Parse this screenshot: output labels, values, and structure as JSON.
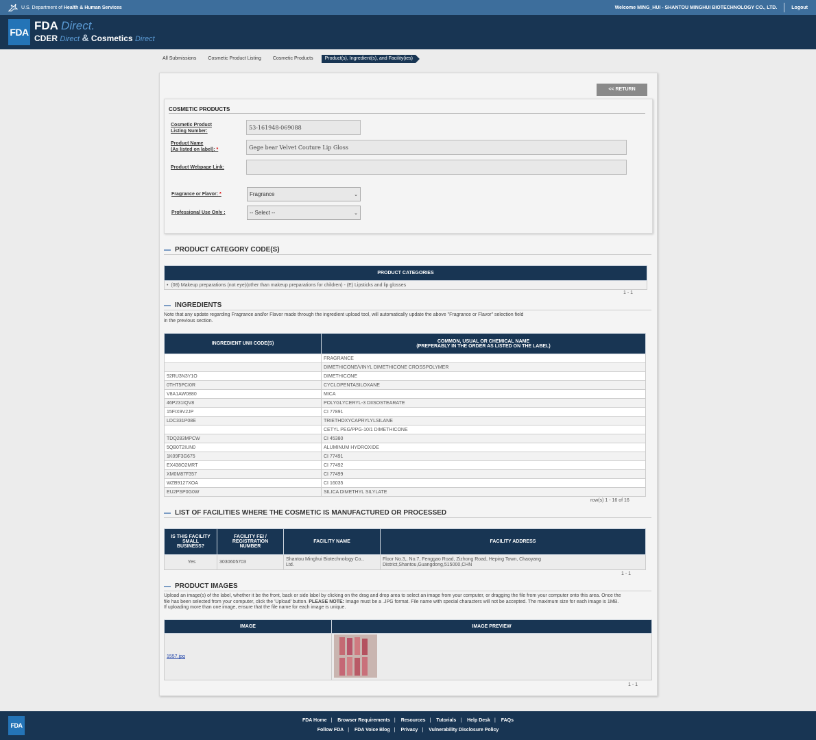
{
  "hhs": {
    "prefix": "U.S. Department of",
    "dept": "Health & Human Services",
    "welcome": "Welcome MING_HUI - SHANTOU MINGHUI BIOTECHNOLOGY CO., LTD.",
    "logout": "Logout"
  },
  "brand": {
    "logo": "FDA",
    "fda": "FDA",
    "direct": "Direct.",
    "cder": "CDER",
    "direct2": "Direct",
    "amp": "&",
    "cosmetics": "Cosmetics",
    "direct3": "Direct"
  },
  "breadcrumbs": [
    "All Submissions",
    "Cosmetic Product Listing",
    "Cosmetic Products",
    "Product(s), Ingredient(s), and Facility(ies)"
  ],
  "return_button": "<< RETURN",
  "cosmetic_products": {
    "title": "COSMETIC PRODUCTS",
    "listing_label_1": "Cosmetic Product",
    "listing_label_2": "Listing Number:",
    "listing_value": "53-161948-069088",
    "name_label_1": "Product Name",
    "name_label_2": "(As listed on label):",
    "name_value": "Gege bear Velvet Couture Lip Gloss",
    "webpage_label": "Product Webpage Link:",
    "webpage_value": "",
    "fragrance_label": "Fragrance or Flavor:",
    "fragrance_value": "Fragrance",
    "professional_label": "Professional Use Only :",
    "professional_value": "-- Select --",
    "required_mark": "*"
  },
  "categories": {
    "title": "PRODUCT CATEGORY CODE(S)",
    "header": "PRODUCT CATEGORIES",
    "bullet": "•",
    "row": "(08) Makeup preparations (not eye)(other than makeup preparations for children) - (E) Lipsticks and lip glosses",
    "pager": "1 - 1"
  },
  "ingredients": {
    "title": "INGREDIENTS",
    "note_1": "Note that any update regarding Fragrance and/or Flavor made through the ingredient upload tool, will automatically update the above \"Fragrance or Flavor\" selection field",
    "note_2": "in the previous section.",
    "col_code": "INGREDIENT UNII CODE(S)",
    "col_name_1": "COMMON, USUAL OR CHEMICAL NAME",
    "col_name_2": "(PREFERABLY IN THE ORDER AS LISTED ON THE LABEL)",
    "rows": [
      {
        "code": "",
        "name": "FRAGRANCE"
      },
      {
        "code": "",
        "name": "DIMETHICONE/VINYL DIMETHICONE CROSSPOLYMER"
      },
      {
        "code": "92RU3N3Y1O",
        "name": "DIMETHICONE"
      },
      {
        "code": "0THT5PCI0R",
        "name": "CYCLOPENTASILOXANE"
      },
      {
        "code": "V8A1AW0880",
        "name": "MICA"
      },
      {
        "code": "46P231IQV8",
        "name": "POLYGLYCERYL-3 DIISOSTEARATE"
      },
      {
        "code": "15FIX9V2JP",
        "name": "CI 77891"
      },
      {
        "code": "LDC331P08E",
        "name": "TRIETHOXYCAPRYLYLSILANE"
      },
      {
        "code": "",
        "name": "CETYL PEG/PPG-10/1 DIMETHICONE"
      },
      {
        "code": "TDQ283MPCW",
        "name": "CI 45380"
      },
      {
        "code": "5QB0T2IUN0",
        "name": "ALUMINUM HYDROXIDE"
      },
      {
        "code": "1K09F3G675",
        "name": "CI 77491"
      },
      {
        "code": "EX438O2MRT",
        "name": "CI 77492"
      },
      {
        "code": "XM0M87F357",
        "name": "CI 77499"
      },
      {
        "code": "WZB9127XOA",
        "name": "CI 16035"
      },
      {
        "code": "EU2PSP0G0W",
        "name": "SILICA DIMETHYL SILYLATE"
      }
    ],
    "pager": "row(s) 1 - 16 of 16"
  },
  "facilities": {
    "title": "LIST OF FACILITIES WHERE THE COSMETIC IS MANUFACTURED OR PROCESSED",
    "col_small_1": "IS THIS FACILITY",
    "col_small_2": "SMALL",
    "col_small_3": "BUSINESS?",
    "col_fei_1": "FACILITY FEI /",
    "col_fei_2": "REGISTRATION",
    "col_fei_3": "NUMBER",
    "col_name": "FACILITY NAME",
    "col_address": "FACILITY ADDRESS",
    "small": "Yes",
    "fei": "3030605703",
    "name_1": "Shantou Minghui Biotechnology Co.,",
    "name_2": "Ltd.",
    "address_1": "Floor No.3,, No.7, Fenggao Road, Zizhong Road, Heping Town, Chaoyang",
    "address_2": "District,Shantou,Guangdong,515000,CHN",
    "pager": "1 - 1"
  },
  "images": {
    "title": "PRODUCT IMAGES",
    "note_1": "Upload an image(s) of the label, whether it be the front, back or side label by clicking on the drag and drop area to select an image from your computer, or dragging the file from your computer onto this area. Once the",
    "note_2a": "file has been selected from your computer, click the 'Upload' button.",
    "note_2b": "PLEASE NOTE:",
    "note_2c": "Image must be a .JPG format. File name with special characters will not be accepted. The maximum size for each image is 1MB.",
    "note_3": "If uploading more than one image, ensure that the file name for each image is unique.",
    "col_image": "IMAGE",
    "col_preview": "IMAGE PREVIEW",
    "file": "1557.jpg",
    "pager": "1 - 1"
  },
  "footer": {
    "logo": "FDA",
    "row1": [
      "FDA Home",
      "Browser Requirements",
      "Resources",
      "Tutorials",
      "Help Desk",
      "FAQs"
    ],
    "row2": [
      "Follow FDA",
      "FDA Voice Blog",
      "Privacy",
      "Vulnerability Disclosure Policy"
    ],
    "separator": "|"
  },
  "colors": {
    "navy": "#183553",
    "hhs_blue": "#3d6e9c",
    "fda_blue": "#2474b7",
    "required": "#dd0000"
  }
}
